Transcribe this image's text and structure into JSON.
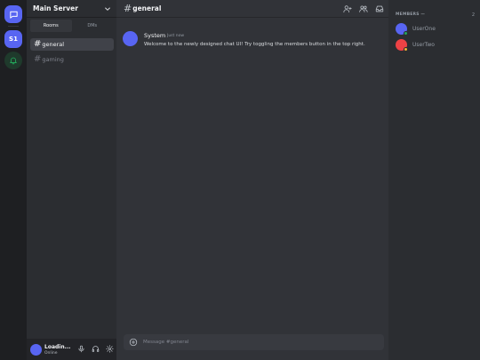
{
  "rail": {
    "home_icon": "chat-bubble-icon",
    "server_label": "S1",
    "notification_icon": "bell-icon",
    "colors": {
      "accent": "#5865f2",
      "notif_bg": "#1f3a2c",
      "notif_icon": "#23a55a"
    }
  },
  "sidebar": {
    "server_name": "Main Server",
    "tabs": [
      {
        "label": "Rooms",
        "active": true
      },
      {
        "label": "DMs",
        "active": false
      }
    ],
    "channels": [
      {
        "label": "general",
        "active": true
      },
      {
        "label": "gaming",
        "active": false
      }
    ]
  },
  "user_panel": {
    "name": "Loadin...",
    "status": "Online",
    "icons": [
      "microphone-icon",
      "headphones-icon",
      "gear-icon"
    ]
  },
  "chat": {
    "channel_name": "general",
    "header_icons": [
      "add-user-icon",
      "members-icon",
      "inbox-icon"
    ],
    "messages": [
      {
        "author": "System",
        "time": "Just now",
        "text": "Welcome to the newly designed chat UI! Try toggling the members button in the top right."
      }
    ],
    "composer_placeholder": "Message #general"
  },
  "members": {
    "header": "MEMBERS —",
    "count": "2",
    "list": [
      {
        "name": "UserOne",
        "avatar_color": "#5865f2",
        "status_color": "#23a55a"
      },
      {
        "name": "UserTwo",
        "avatar_color": "#ed4245",
        "status_color": "#f0b232"
      }
    ]
  }
}
